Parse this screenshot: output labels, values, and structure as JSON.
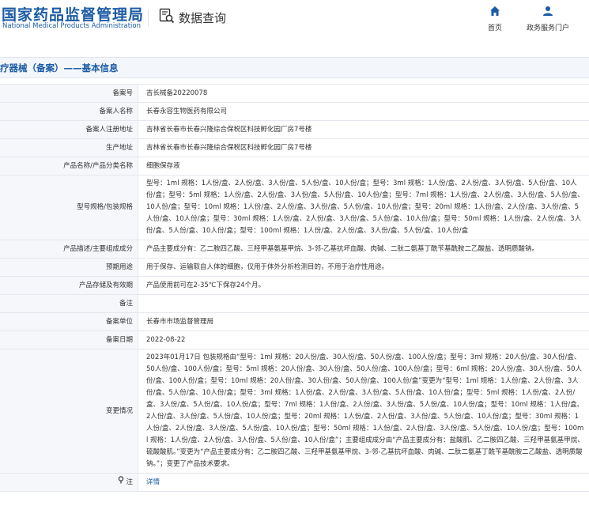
{
  "header": {
    "logo_cn": "国家药品监督管理局",
    "logo_en": "National Medical Products Administration",
    "data_query": "数据查询",
    "nav": [
      {
        "label": "首页",
        "icon": "home-icon"
      },
      {
        "label": "政务服务门户",
        "icon": "users-icon"
      }
    ]
  },
  "section": {
    "title": "疗器械（备案）——基本信息"
  },
  "rows": [
    {
      "key": "备案号",
      "value": "吉长械备20220078"
    },
    {
      "key": "备案人名称",
      "value": "长春永容生物医药有限公司"
    },
    {
      "key": "备案人注册地址",
      "value": "吉林省长春市长春兴隆综合保税区科技孵化园厂房7号楼"
    },
    {
      "key": "生产地址",
      "value": "吉林省长春市长春兴隆综合保税区科技孵化园厂房7号楼"
    },
    {
      "key": "产品名称/产品分类名称",
      "value": "细胞保存液"
    },
    {
      "key": "型号规格/包装规格",
      "value": "型号：1ml 规格：1人份/盒、2人份/盒、3人份/盒、5人份/盒、10人份/盒；型号：3ml 规格：1人份/盒、2人份/盒、3人份/盒、5人份/盒、10人份/盒；型号：5ml 规格：1人份/盒、2人份/盒、3人份/盒、5人份/盒、10人份/盒；型号：7ml 规格：1人份/盒、2人份/盒、3人份/盒、5人份/盒、10人份/盒；型号：10ml 规格：1人份/盒、2人份/盒、3人份/盒、5人份/盒、10人份/盒；型号：20ml 规格：1人份/盒、2人份/盒、3人份/盒、5人份/盒、10人份/盒；型号：30ml 规格：1人份/盒、2人份/盒、3人份/盒、5人份/盒、10人份/盒；型号：50ml 规格：1人份/盒、2人份/盒、3人份/盒、5人份/盒、10人份/盒；型号：100ml 规格：1人份/盒、2人份/盒、3人份/盒、5人份/盒、10人份/盒"
    },
    {
      "key": "产品描述/主要组成成分",
      "value": "产品主要成分有：乙二胺四乙酸、三羟甲基氨基甲烷、3-邻-乙基抗坏血酸、肉碱、二肽二氨基丁酰苄基酰胺二乙酸盐、透明质酸钠。"
    },
    {
      "key": "预期用途",
      "value": "用于保存、运输取自人体的细胞，仅用于体外分析检测目的，不用于治疗性用途。"
    },
    {
      "key": "产品存储及有效期",
      "value": "产品使用前可在2-35℃下保存24个月。"
    },
    {
      "key": "备注",
      "value": ""
    },
    {
      "key": "备案单位",
      "value": "长春市市场监督管理局"
    },
    {
      "key": "备案日期",
      "value": "2022-08-22"
    },
    {
      "key": "变更情况",
      "value": "2023年01月17日 包装规格由“型号：1ml 规格：20人份/盒、30人份/盒、50人份/盒、100人份/盒；型号：3ml 规格：20人份/盒、30人份/盒、50人份/盒、100人份/盒；型号：5ml 规格：20人份/盒、30人份/盒、50人份/盒、100人份/盒；型号：6ml 规格：20人份/盒、30人份/盒、50人份/盒、100人份/盒；型号：10ml 规格：20人份/盒、30人份/盒、50人份/盒、100人份/盒”变更为“型号：1ml 规格：1人份/盒、2人份/盒、3人份/盒、5人份/盒、10人份/盒；型号：3ml 规格：1人份/盒、2人份/盒、3人份/盒、5人份/盒、10人份/盒；型号：5ml 规格：1人份/盒、2人份/盒、3人份/盒、5人份/盒、10人份/盒；型号：7ml 规格：1人份/盒、2人份/盒、3人份/盒、5人份/盒、10人份/盒；型号：10ml 规格：1人份/盒、2人份/盒、3人份/盒、5人份/盒、10人份/盒；型号：20ml 规格：1人份/盒、2人份/盒、3人份/盒、5人份/盒、10人份/盒；型号：30ml 规格：1人份/盒、2人份/盒、3人份/盒、5人份/盒、10人份/盒；型号：50ml 规格：1人份/盒、2人份/盒、3人份/盒、5人份/盒、10人份/盒；型号：100ml 规格：1人份/盒、2人份/盒、3人份/盒、5人份/盒、10人份/盒”；主要组成成分由“产品主要成分有：盐酸肌、乙二胺四乙酸、三羟甲基氨基甲烷、硫酸酸肌。”变更为“产品主要成分有：乙二胺四乙酸、三羟甲基氨基甲烷、3-邻-乙基抗坏血酸、肉碱、二肽二氨基丁酰苄基酰胺二乙酸盐、透明质酸钠。”；变更了产品技术要求。"
    }
  ],
  "note_row": {
    "key": "注",
    "link": "详情"
  },
  "colors": {
    "brand": "#1c5ba6",
    "key_bg": "#f5f7fa",
    "border": "#e4e8ee"
  }
}
